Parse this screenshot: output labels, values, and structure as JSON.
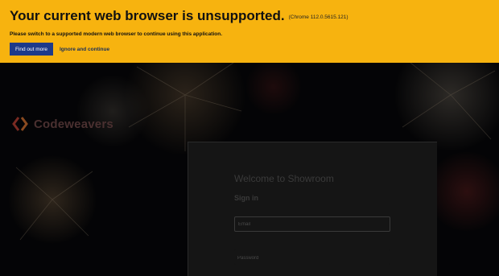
{
  "banner": {
    "title": "Your current web browser is unsupported.",
    "browser_version": "(Chrome 112.0.5615.121)",
    "message": "Please switch to a supported modern web browser to continue using this application.",
    "find_out_more_label": "Find out more",
    "ignore_label": "Ignore and continue",
    "background_color": "#f7b30f",
    "button_color": "#1d3a8a"
  },
  "brand": {
    "name": "Codeweavers",
    "logo_icon": "codeweavers-logo-icon"
  },
  "login": {
    "heading": "Welcome to Showroom",
    "subheading": "Sign in",
    "email_placeholder": "Email",
    "password_placeholder": "Password"
  }
}
